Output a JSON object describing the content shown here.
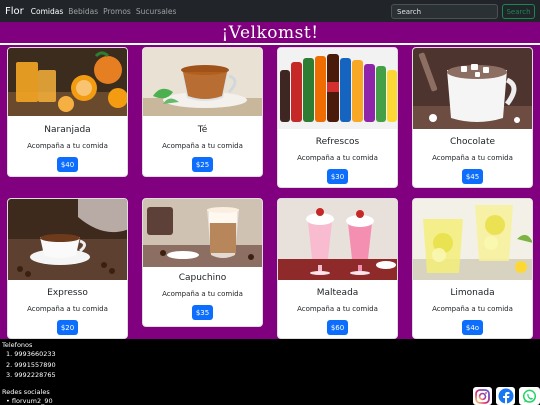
{
  "navbar": {
    "brand": "Flor",
    "links": [
      "Comidas",
      "Bebidas",
      "Promos",
      "Sucursales"
    ],
    "search_placeholder": "Search",
    "search_button": "Search"
  },
  "banner": {
    "title": "¡Velkomst!"
  },
  "cards": [
    {
      "title": "Naranjada",
      "text": "Acompaña a tu comida",
      "price": "$40"
    },
    {
      "title": "Té",
      "text": "Acompaña a tu comida",
      "price": "$25"
    },
    {
      "title": "Refrescos",
      "text": "Acompaña a tu comida",
      "price": "$30"
    },
    {
      "title": "Chocolate",
      "text": "Acompaña a tu comida",
      "price": "$45"
    },
    {
      "title": "Expresso",
      "text": "Acompaña a tu comida",
      "price": "$20"
    },
    {
      "title": "Capuchino",
      "text": "Acompaña a tu comida",
      "price": "$35"
    },
    {
      "title": "Malteada",
      "text": "Acompaña a tu comida",
      "price": "$60"
    },
    {
      "title": "Limonada",
      "text": "Acompaña a tu comida",
      "price": "$4o"
    }
  ],
  "footer": {
    "phones_title": "Telefonos",
    "phones": [
      "9993660233",
      "9991557890",
      "9992228765"
    ],
    "social_title": "Redes sociales",
    "social_items": [
      "florvum2_90"
    ],
    "social_icons": [
      "instagram-icon",
      "facebook-icon",
      "whatsapp-icon"
    ]
  },
  "colors": {
    "banner": "#800080",
    "navbar": "#212529",
    "button": "#0d6efd",
    "search_button": "#198754"
  }
}
